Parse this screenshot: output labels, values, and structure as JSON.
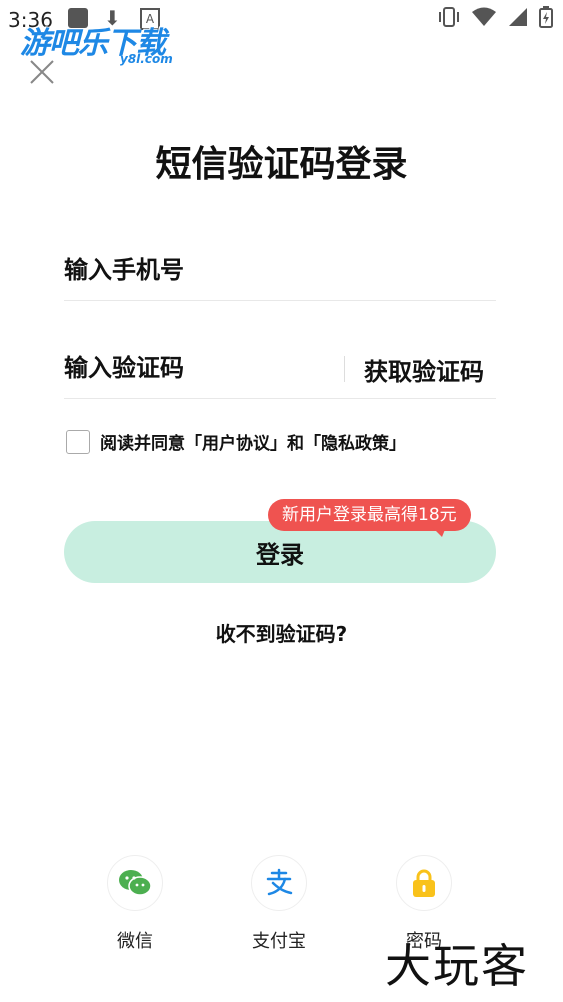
{
  "status_bar": {
    "time": "3:36",
    "notif_a": "A"
  },
  "watermark": {
    "logo_text": "游吧乐下载",
    "logo_sub": "y8l.com",
    "bottom_text": "大玩客"
  },
  "title": "短信验证码登录",
  "phone_field": {
    "placeholder": "输入手机号"
  },
  "code_field": {
    "placeholder": "输入验证码",
    "get_code_label": "获取验证码"
  },
  "agreement": {
    "text": "阅读并同意「用户协议」和「隐私政策」"
  },
  "login": {
    "button_label": "登录",
    "promo_badge": "新用户登录最高得18元"
  },
  "no_code_link": "收不到验证码?",
  "social_login": [
    {
      "label": "微信",
      "icon": "wechat-icon",
      "color": "#4caf50"
    },
    {
      "label": "支付宝",
      "icon": "alipay-icon",
      "color": "#1e88e5"
    },
    {
      "label": "密码",
      "icon": "lock-icon",
      "color": "#f9c21b"
    }
  ],
  "colors": {
    "login_button": "#c8eee0",
    "promo": "#ef5350"
  }
}
